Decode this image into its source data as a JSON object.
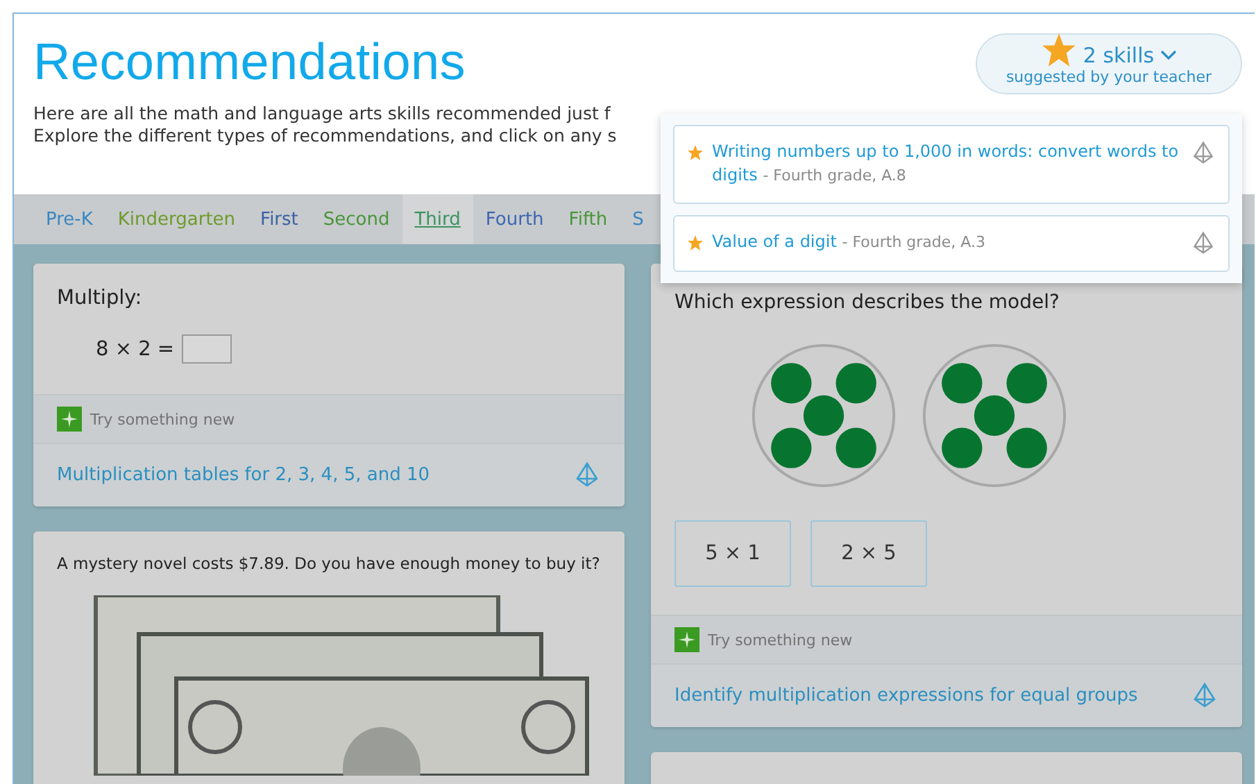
{
  "header": {
    "title": "Recommendations",
    "intro": [
      "Here are all the math and language arts skills recommended just f",
      "Explore the different types of recommendations, and click on any s"
    ]
  },
  "teacher_skills": {
    "count": "2 skills",
    "subtitle": "suggested by your teacher",
    "expanded": true,
    "items": [
      {
        "name": "Writing numbers up to 1,000 in words: convert words to digits",
        "detail": "- Fourth grade, A.8"
      },
      {
        "name": "Value of a digit",
        "detail": "- Fourth grade, A.3"
      }
    ]
  },
  "grade_tabs": [
    {
      "label": "Pre-K",
      "color": "#3a86c0",
      "selected": false
    },
    {
      "label": "Kindergarten",
      "color": "#6f9a2c",
      "selected": false
    },
    {
      "label": "First",
      "color": "#3c62a4",
      "selected": false
    },
    {
      "label": "Second",
      "color": "#4a953a",
      "selected": false
    },
    {
      "label": "Third",
      "color": "#3a9460",
      "selected": true
    },
    {
      "label": "Fourth",
      "color": "#3d66b4",
      "selected": false
    },
    {
      "label": "Fifth",
      "color": "#4a953a",
      "selected": false
    },
    {
      "label": "S",
      "color": "#3a86c0",
      "selected": false
    }
  ],
  "columns": [
    [
      {
        "kind": "fill_in",
        "prompt": "Multiply:",
        "equation": "8 × 2 =",
        "tag": "Try something new",
        "skill": "Multiplication tables for 2, 3, 4, 5, and 10"
      },
      {
        "kind": "picture",
        "prompt": "A mystery novel costs $7.89. Do you have enough money to buy it?"
      }
    ],
    [
      {
        "kind": "multiple_choice",
        "prompt": "Which expression describes the model?",
        "choices": [
          "5 × 1",
          "2 × 5"
        ],
        "tag": "Try something new",
        "skill": "Identify multiplication expressions for equal groups"
      },
      {
        "kind": "empty"
      }
    ]
  ]
}
